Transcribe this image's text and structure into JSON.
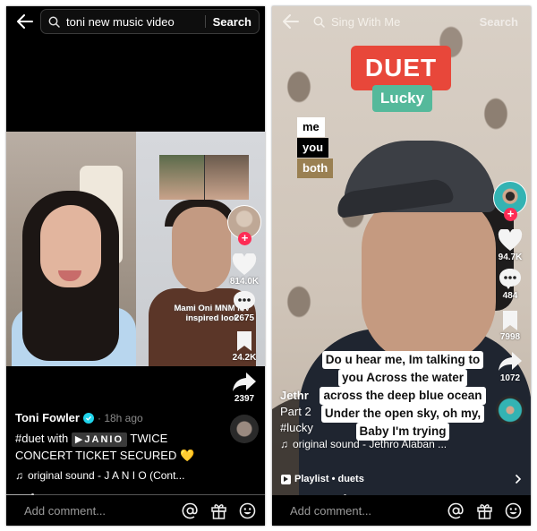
{
  "left": {
    "search": {
      "query": "toni new music video",
      "button": "Search"
    },
    "video": {
      "overlay_caption": "Mami Oni MNM MV inspired look"
    },
    "actions": {
      "likes": "814.0K",
      "comments": "2675",
      "saves": "24.2K",
      "shares": "2397"
    },
    "post": {
      "author": "Toni Fowler",
      "time_ago": "· 18h ago",
      "hashtag": "#duet",
      "with_text": "with",
      "mention_chip": "▶JANIO",
      "description_rest": "TWICE CONCERT TICKET SECURED",
      "emoji": "💛",
      "sound": "original sound - J A N I O (Cont..."
    },
    "progress": 0.1,
    "comment_placeholder": "Add comment..."
  },
  "right": {
    "search": {
      "query": "Sing With Me",
      "button": "Search"
    },
    "sticker": {
      "title": "DUET",
      "subtitle": "Lucky"
    },
    "options": [
      "me",
      "you",
      "both"
    ],
    "lyrics": [
      "Do u hear me, Im talking to",
      "you Across the water",
      "across the deep blue ocean",
      "Under the open sky, oh my,",
      "Baby I'm trying"
    ],
    "actions": {
      "likes": "94.7K",
      "comments": "484",
      "saves": "7998",
      "shares": "1072"
    },
    "post": {
      "author": "Jethr",
      "line2": "Part 2",
      "hashtag": "#lucky",
      "sound": "original sound - Jethro Alaban ..."
    },
    "playlist": "Playlist • duets",
    "progress": 0.28,
    "comment_placeholder": "Add comment..."
  },
  "colors": {
    "accent_red": "#fe2c55",
    "duet_red": "#e8473a",
    "lucky_green": "#55b99b",
    "both_gold": "#9a8052",
    "verified_blue": "#20d5ec"
  }
}
